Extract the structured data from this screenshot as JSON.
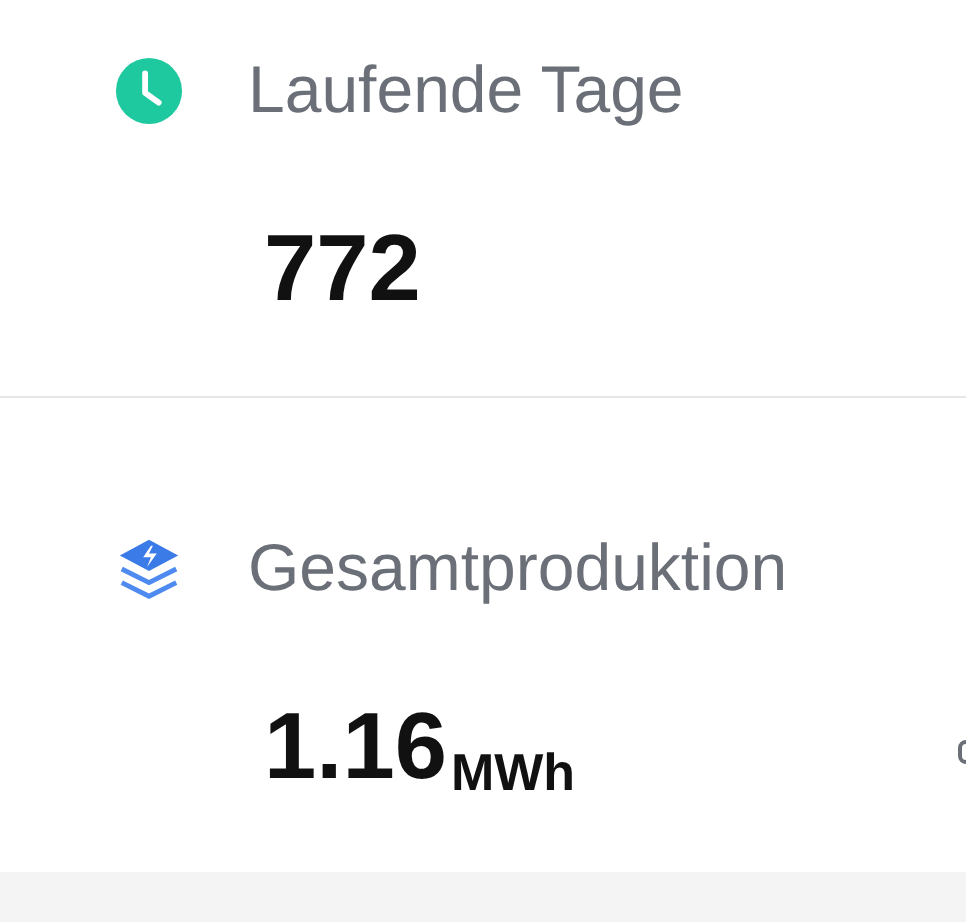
{
  "stats": [
    {
      "kind": "clock",
      "label": "Laufende Tage",
      "value": "772"
    },
    {
      "kind": "energy",
      "label": "Gesamtproduktion",
      "value": "1.16",
      "unit": "MWh"
    }
  ]
}
